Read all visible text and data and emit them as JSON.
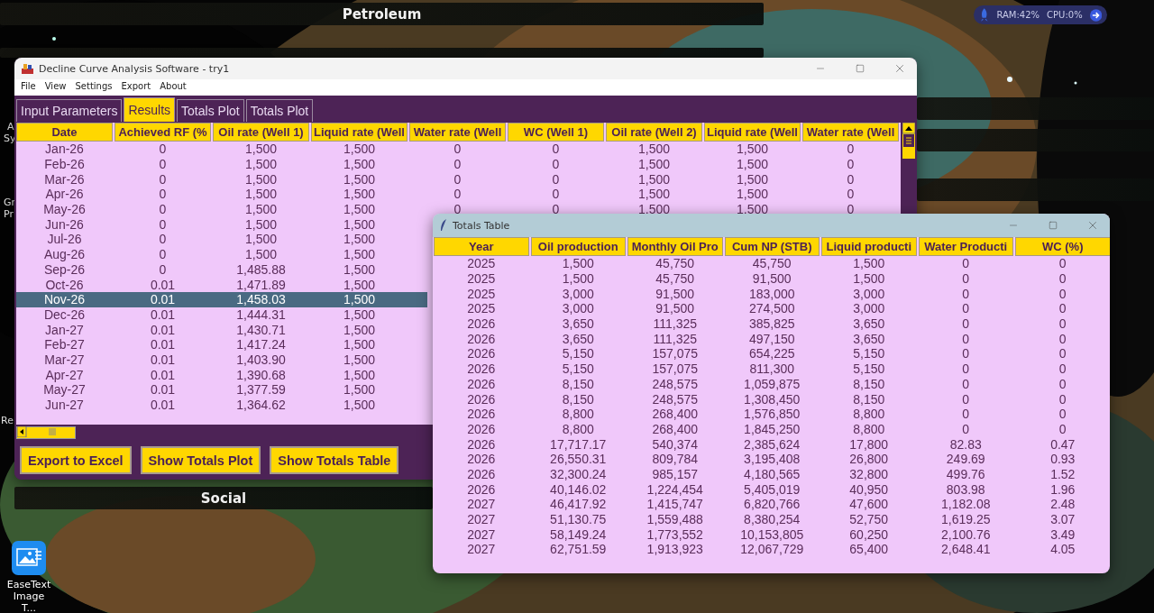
{
  "desktop": {
    "fences": [
      "Petroleum",
      "Social"
    ],
    "icon_label_fragments": [
      "A",
      "Sy",
      "Gr",
      "Pr",
      "Re"
    ],
    "shortcut": {
      "label": "EaseText Image T..."
    }
  },
  "system_widget": {
    "ram": "RAM:42%",
    "cpu": "CPU:0%"
  },
  "main_window": {
    "title": "Decline Curve Analysis Software - try1",
    "menu": [
      "File",
      "View",
      "Settings",
      "Export",
      "About"
    ],
    "tabs": [
      {
        "label": "Input Parameters",
        "selected": false
      },
      {
        "label": "Results",
        "selected": true
      },
      {
        "label": "Totals Plot",
        "selected": false
      },
      {
        "label": "Totals Plot",
        "selected": false
      }
    ],
    "table": {
      "columns": [
        "Date",
        "Achieved RF (%",
        "Oil rate (Well 1)",
        "Liquid rate (Well",
        "Water rate (Well",
        "WC (Well 1)",
        "Oil rate (Well 2)",
        "Liquid rate (Well",
        "Water rate (Well"
      ],
      "rows": [
        {
          "cells": [
            "Jan-26",
            "0",
            "1,500",
            "1,500",
            "0",
            "0",
            "1,500",
            "1,500",
            "0"
          ],
          "selected": false
        },
        {
          "cells": [
            "Feb-26",
            "0",
            "1,500",
            "1,500",
            "0",
            "0",
            "1,500",
            "1,500",
            "0"
          ],
          "selected": false
        },
        {
          "cells": [
            "Mar-26",
            "0",
            "1,500",
            "1,500",
            "0",
            "0",
            "1,500",
            "1,500",
            "0"
          ],
          "selected": false
        },
        {
          "cells": [
            "Apr-26",
            "0",
            "1,500",
            "1,500",
            "0",
            "0",
            "1,500",
            "1,500",
            "0"
          ],
          "selected": false
        },
        {
          "cells": [
            "May-26",
            "0",
            "1,500",
            "1,500",
            "0",
            "0",
            "1,500",
            "1,500",
            "0"
          ],
          "selected": false
        },
        {
          "cells": [
            "Jun-26",
            "0",
            "1,500",
            "1,500"
          ],
          "selected": false
        },
        {
          "cells": [
            "Jul-26",
            "0",
            "1,500",
            "1,500"
          ],
          "selected": false
        },
        {
          "cells": [
            "Aug-26",
            "0",
            "1,500",
            "1,500"
          ],
          "selected": false
        },
        {
          "cells": [
            "Sep-26",
            "0",
            "1,485.88",
            "1,500"
          ],
          "selected": false
        },
        {
          "cells": [
            "Oct-26",
            "0.01",
            "1,471.89",
            "1,500"
          ],
          "selected": false
        },
        {
          "cells": [
            "Nov-26",
            "0.01",
            "1,458.03",
            "1,500"
          ],
          "selected": true
        },
        {
          "cells": [
            "Dec-26",
            "0.01",
            "1,444.31",
            "1,500"
          ],
          "selected": false
        },
        {
          "cells": [
            "Jan-27",
            "0.01",
            "1,430.71",
            "1,500"
          ],
          "selected": false
        },
        {
          "cells": [
            "Feb-27",
            "0.01",
            "1,417.24",
            "1,500"
          ],
          "selected": false
        },
        {
          "cells": [
            "Mar-27",
            "0.01",
            "1,403.90",
            "1,500"
          ],
          "selected": false
        },
        {
          "cells": [
            "Apr-27",
            "0.01",
            "1,390.68",
            "1,500"
          ],
          "selected": false
        },
        {
          "cells": [
            "May-27",
            "0.01",
            "1,377.59",
            "1,500"
          ],
          "selected": false
        },
        {
          "cells": [
            "Jun-27",
            "0.01",
            "1,364.62",
            "1,500"
          ],
          "selected": false
        }
      ]
    },
    "buttons": [
      "Export to Excel",
      "Show Totals Plot",
      "Show Totals Table"
    ]
  },
  "totals_window": {
    "title": "Totals Table",
    "table": {
      "columns": [
        "Year",
        "Oil production",
        "Monthly Oil Pro",
        "Cum NP (STB)",
        "Liquid producti",
        "Water Producti",
        "WC (%)"
      ],
      "rows": [
        {
          "cells": [
            "2025",
            "1,500",
            "45,750",
            "45,750",
            "1,500",
            "0",
            "0"
          ]
        },
        {
          "cells": [
            "2025",
            "1,500",
            "45,750",
            "91,500",
            "1,500",
            "0",
            "0"
          ]
        },
        {
          "cells": [
            "2025",
            "3,000",
            "91,500",
            "183,000",
            "3,000",
            "0",
            "0"
          ]
        },
        {
          "cells": [
            "2025",
            "3,000",
            "91,500",
            "274,500",
            "3,000",
            "0",
            "0"
          ]
        },
        {
          "cells": [
            "2026",
            "3,650",
            "111,325",
            "385,825",
            "3,650",
            "0",
            "0"
          ]
        },
        {
          "cells": [
            "2026",
            "3,650",
            "111,325",
            "497,150",
            "3,650",
            "0",
            "0"
          ]
        },
        {
          "cells": [
            "2026",
            "5,150",
            "157,075",
            "654,225",
            "5,150",
            "0",
            "0"
          ]
        },
        {
          "cells": [
            "2026",
            "5,150",
            "157,075",
            "811,300",
            "5,150",
            "0",
            "0"
          ]
        },
        {
          "cells": [
            "2026",
            "8,150",
            "248,575",
            "1,059,875",
            "8,150",
            "0",
            "0"
          ]
        },
        {
          "cells": [
            "2026",
            "8,150",
            "248,575",
            "1,308,450",
            "8,150",
            "0",
            "0"
          ]
        },
        {
          "cells": [
            "2026",
            "8,800",
            "268,400",
            "1,576,850",
            "8,800",
            "0",
            "0"
          ]
        },
        {
          "cells": [
            "2026",
            "8,800",
            "268,400",
            "1,845,250",
            "8,800",
            "0",
            "0"
          ]
        },
        {
          "cells": [
            "2026",
            "17,717.17",
            "540,374",
            "2,385,624",
            "17,800",
            "82.83",
            "0.47"
          ]
        },
        {
          "cells": [
            "2026",
            "26,550.31",
            "809,784",
            "3,195,408",
            "26,800",
            "249.69",
            "0.93"
          ]
        },
        {
          "cells": [
            "2026",
            "32,300.24",
            "985,157",
            "4,180,565",
            "32,800",
            "499.76",
            "1.52"
          ]
        },
        {
          "cells": [
            "2026",
            "40,146.02",
            "1,224,454",
            "5,405,019",
            "40,950",
            "803.98",
            "1.96"
          ]
        },
        {
          "cells": [
            "2027",
            "46,417.92",
            "1,415,747",
            "6,820,766",
            "47,600",
            "1,182.08",
            "2.48"
          ]
        },
        {
          "cells": [
            "2027",
            "51,130.75",
            "1,559,488",
            "8,380,254",
            "52,750",
            "1,619.25",
            "3.07"
          ]
        },
        {
          "cells": [
            "2027",
            "58,149.24",
            "1,773,552",
            "10,153,805",
            "60,250",
            "2,100.76",
            "3.49"
          ]
        },
        {
          "cells": [
            "2027",
            "62,751.59",
            "1,913,923",
            "12,067,729",
            "65,400",
            "2,648.41",
            "4.05"
          ]
        }
      ]
    }
  }
}
